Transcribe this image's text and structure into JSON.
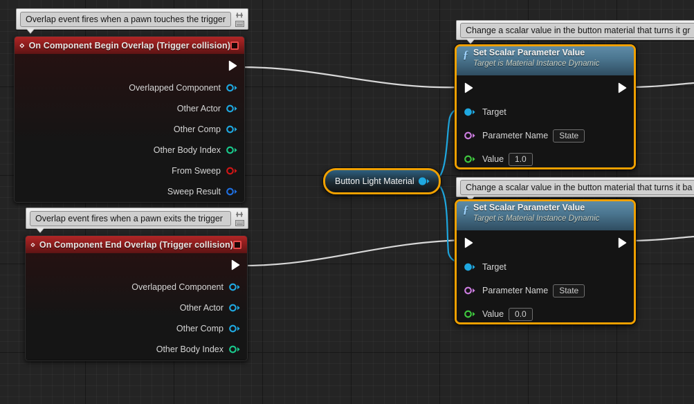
{
  "canvas": {
    "app": "Unreal Engine Blueprint Graph",
    "background_color": "#242424",
    "grid_color": "#2e2e2e",
    "selection_color": "#f0a000",
    "exec_wire_color": "#d9d9d9",
    "object_wire_color": "#1fa8e0"
  },
  "comments": [
    {
      "id": "comment-begin-overlap",
      "text": "Overlap event fires when a pawn touches the trigger",
      "pin_icon": "pin-icon",
      "menu_icon": "keyboard-icon"
    },
    {
      "id": "comment-end-overlap",
      "text": "Overlap event fires when a pawn exits the trigger",
      "pin_icon": "pin-icon",
      "menu_icon": "keyboard-icon"
    },
    {
      "id": "comment-set-scalar-on",
      "text": "Change a scalar value in the button material that turns it gr",
      "pin_icon": "pin-icon",
      "menu_icon": "keyboard-icon"
    },
    {
      "id": "comment-set-scalar-off",
      "text": "Change a scalar value in the button material that turns it ba",
      "pin_icon": "pin-icon",
      "menu_icon": "keyboard-icon"
    }
  ],
  "nodes": {
    "begin_overlap": {
      "title": "On Component Begin Overlap (Trigger collision)",
      "header_color": "#a02323",
      "event_icon": "event-diamond-icon",
      "breakpoint_icon": "red-square-icon",
      "exec_out": "exec-out-pin",
      "outputs": [
        {
          "label": "Overlapped Component",
          "type": "object",
          "color": "#1fa8e0"
        },
        {
          "label": "Other Actor",
          "type": "object",
          "color": "#1fa8e0"
        },
        {
          "label": "Other Comp",
          "type": "object",
          "color": "#1fa8e0"
        },
        {
          "label": "Other Body Index",
          "type": "integer",
          "color": "#19c98c"
        },
        {
          "label": "From Sweep",
          "type": "boolean",
          "color": "#d01616"
        },
        {
          "label": "Sweep Result",
          "type": "struct",
          "color": "#1f6fe0"
        }
      ]
    },
    "end_overlap": {
      "title": "On Component End Overlap (Trigger collision)",
      "header_color": "#a02323",
      "event_icon": "event-diamond-icon",
      "breakpoint_icon": "red-square-icon",
      "exec_out": "exec-out-pin",
      "outputs": [
        {
          "label": "Overlapped Component",
          "type": "object",
          "color": "#1fa8e0"
        },
        {
          "label": "Other Actor",
          "type": "object",
          "color": "#1fa8e0"
        },
        {
          "label": "Other Comp",
          "type": "object",
          "color": "#1fa8e0"
        },
        {
          "label": "Other Body Index",
          "type": "integer",
          "color": "#19c98c"
        }
      ]
    },
    "variable_getter": {
      "label": "Button Light Material",
      "pin_color": "#1fa8e0",
      "selected": true
    },
    "set_scalar_on": {
      "title": "Set Scalar Parameter Value",
      "subtitle": "Target is Material Instance Dynamic",
      "function_icon": "function-f-icon",
      "selected": true,
      "inputs": [
        {
          "label": "Target",
          "type": "object",
          "color": "#1fa8e0",
          "value": ""
        },
        {
          "label": "Parameter Name",
          "type": "name",
          "color": "#cc7de0",
          "value": "State"
        },
        {
          "label": "Value",
          "type": "float",
          "color": "#3fc93f",
          "value": "1.0"
        }
      ]
    },
    "set_scalar_off": {
      "title": "Set Scalar Parameter Value",
      "subtitle": "Target is Material Instance Dynamic",
      "function_icon": "function-f-icon",
      "selected": true,
      "inputs": [
        {
          "label": "Target",
          "type": "object",
          "color": "#1fa8e0",
          "value": ""
        },
        {
          "label": "Parameter Name",
          "type": "name",
          "color": "#cc7de0",
          "value": "State"
        },
        {
          "label": "Value",
          "type": "float",
          "color": "#3fc93f",
          "value": "0.0"
        }
      ]
    }
  }
}
